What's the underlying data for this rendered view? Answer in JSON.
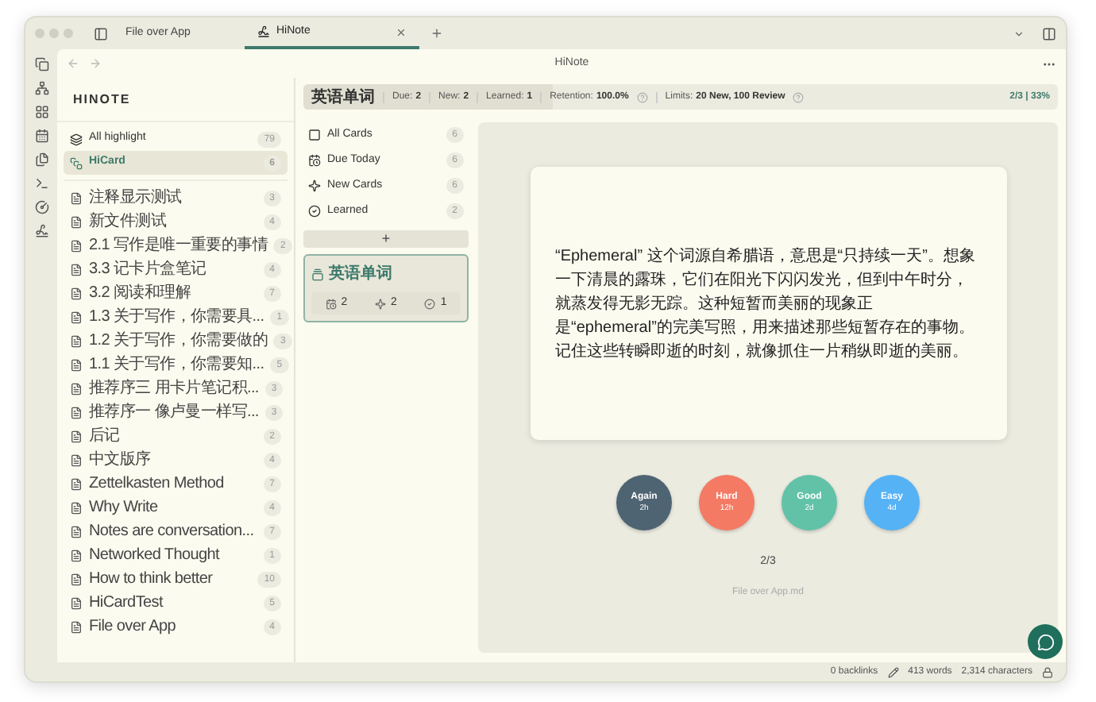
{
  "tabs": [
    {
      "label": "File over App",
      "selected": false
    },
    {
      "label": "HiNote",
      "selected": true
    }
  ],
  "nav": {
    "title": "HiNote"
  },
  "sidebar": {
    "title": "HINOTE",
    "pinned": [
      {
        "label": "All highlight",
        "count": "79",
        "selected": false
      },
      {
        "label": "HiCard",
        "count": "6",
        "selected": true
      }
    ],
    "files": [
      {
        "label": "注释显示测试",
        "count": "3",
        "selected": false
      },
      {
        "label": "新文件测试",
        "count": "4",
        "selected": false
      },
      {
        "label": "2.1 写作是唯一重要的事情",
        "count": "2",
        "selected": false
      },
      {
        "label": "3.3 记卡片盒笔记",
        "count": "4",
        "selected": false
      },
      {
        "label": "3.2 阅读和理解",
        "count": "7",
        "selected": false
      },
      {
        "label": "1.3 关于写作，你需要具...",
        "count": "1",
        "selected": false
      },
      {
        "label": "1.2 关于写作，你需要做的",
        "count": "3",
        "selected": false
      },
      {
        "label": "1.1 关于写作，你需要知...",
        "count": "5",
        "selected": false
      },
      {
        "label": "推荐序三 用卡片笔记积...",
        "count": "3",
        "selected": false
      },
      {
        "label": "推荐序一 像卢曼一样写...",
        "count": "3",
        "selected": false
      },
      {
        "label": "后记",
        "count": "2",
        "selected": false
      },
      {
        "label": "中文版序",
        "count": "4",
        "selected": false
      },
      {
        "label": "Zettelkasten Method",
        "count": "7",
        "selected": false
      },
      {
        "label": "Why Write",
        "count": "4",
        "selected": false
      },
      {
        "label": "Notes are conversation...",
        "count": "7",
        "selected": false
      },
      {
        "label": "Networked Thought",
        "count": "1",
        "selected": false
      },
      {
        "label": "How to think better",
        "count": "10",
        "selected": false
      },
      {
        "label": "HiCardTest",
        "count": "5",
        "selected": false
      },
      {
        "label": "File over App",
        "count": "4",
        "selected": false
      }
    ]
  },
  "stats_bar": {
    "deck": "英语单词",
    "level": 0.33,
    "stats": [
      {
        "label": "Due:",
        "value": "2"
      },
      {
        "label": "New:",
        "value": "2"
      },
      {
        "label": "Learned:",
        "value": "1"
      },
      {
        "label": "Retention:",
        "value": "100.0%"
      }
    ],
    "limits_label": "Limits:",
    "limits_value": "20 New, 100 Review",
    "progress": "2/3 | 33%"
  },
  "filters": [
    {
      "label": "All Cards",
      "count": "6",
      "selected": false
    },
    {
      "label": "Due Today",
      "count": "6",
      "selected": false
    },
    {
      "label": "New Cards",
      "count": "6",
      "selected": false
    },
    {
      "label": "Learned",
      "count": "2",
      "selected": false
    }
  ],
  "add_button": "+",
  "deck": {
    "title": "英语单词",
    "selected": true,
    "due": "2",
    "new": "2",
    "learned": "1"
  },
  "card": {
    "text": "“Ephemeral” 这个词源自希腊语，意思是“只持续一天”。想象一下清晨的露珠，它们在阳光下闪闪发光，但到中午时分，就蒸发得无影无踪。这种短暂而美丽的现象正是“ephemeral”的完美写照，用来描述那些短暂存在的事物。记住这些转瞬即逝的时刻，就像抓住一片稍纵即逝的美丽。"
  },
  "answers": [
    {
      "label": "Again",
      "interval": "2h",
      "color": "#4f6472"
    },
    {
      "label": "Hard",
      "interval": "12h",
      "color": "#f47a64"
    },
    {
      "label": "Good",
      "interval": "2d",
      "color": "#62c2a8"
    },
    {
      "label": "Easy",
      "interval": "4d",
      "color": "#55b2f5"
    }
  ],
  "counter": "2/3",
  "source": "File over App.md",
  "status_bar": {
    "backlinks": "0 backlinks",
    "words": "413 words",
    "characters": "2,314 characters"
  }
}
